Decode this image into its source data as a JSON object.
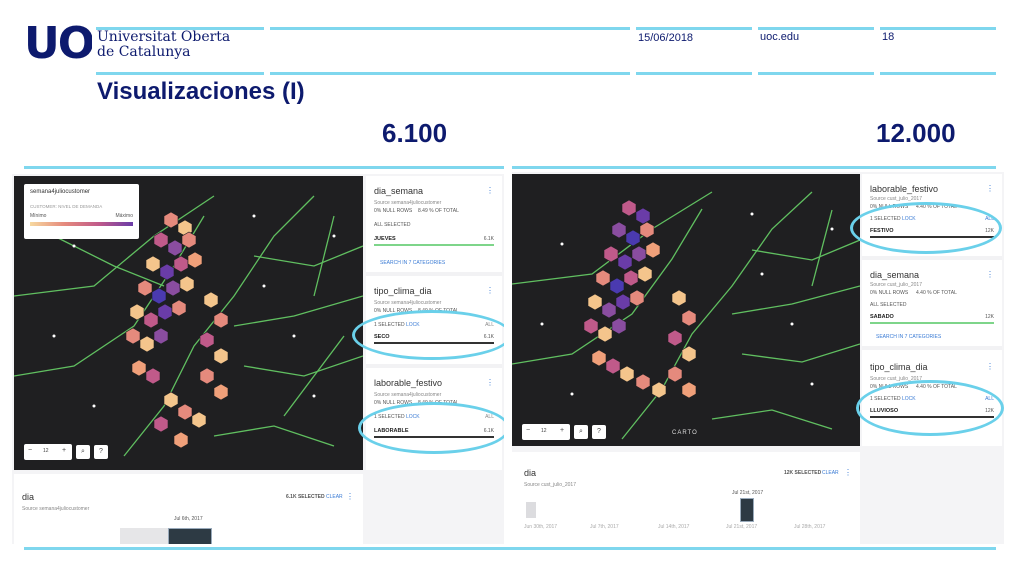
{
  "header": {
    "logo": "UOC",
    "university_line1": "Universitat Oberta",
    "university_line2": "de Catalunya",
    "date": "15/06/2018",
    "site": "uoc.edu",
    "page_number": "18"
  },
  "slide": {
    "title": "Visualizaciones (I)",
    "left_count": "6.100",
    "right_count": "12.000"
  },
  "left_shot": {
    "legend": {
      "layer": "semana4juliocustomer",
      "subtitle": "CUSTOMER: NIVEL DE DEMANDA",
      "min": "Mínimo",
      "max": "Máximo"
    },
    "zoom_level": "12",
    "cards": [
      {
        "title": "dia_semana",
        "source": "Source semana4juliocustomer",
        "null_rows": "0% NULL ROWS",
        "pct_total": "8.49 % OF TOTAL",
        "selected": "ALL SELECTED",
        "value": "JUEVES",
        "value_count": "6.1k",
        "search": "SEARCH IN 7 CATEGORIES"
      },
      {
        "title": "tipo_clima_dia",
        "source": "Source semana4juliocustomer",
        "null_rows": "0% NULL ROWS",
        "pct_total": "8.49 % OF TOTAL",
        "selected": "1 SELECTED",
        "lock": "LOCK",
        "all": "ALL",
        "value": "SECO",
        "value_count": "6.1k"
      },
      {
        "title": "laborable_festivo",
        "source": "Source semana4juliocustomer",
        "null_rows": "0% NULL ROWS",
        "pct_total": "8.49 % OF TOTAL",
        "selected": "1 SELECTED",
        "lock": "LOCK",
        "all": "ALL",
        "value": "LABORABLE",
        "value_count": "6.1k"
      }
    ],
    "timeline": {
      "title": "dia",
      "source": "Source semana4juliocustomer",
      "selected": "6.1K SELECTED",
      "clear": "CLEAR",
      "tooltip": "Jul 6th, 2017"
    }
  },
  "right_shot": {
    "zoom_level": "12",
    "attribution": "CARTO",
    "cards": [
      {
        "title": "laborable_festivo",
        "source": "Source cust_julio_2017",
        "null_rows": "0% NULL ROWS",
        "pct_total": "4.40 % OF TOTAL",
        "selected": "1 SELECTED",
        "lock": "LOCK",
        "all": "ALL",
        "value": "FESTIVO",
        "value_count": "12k"
      },
      {
        "title": "dia_semana",
        "source": "Source cust_julio_2017",
        "null_rows": "0% NULL ROWS",
        "pct_total": "4.40 % OF TOTAL",
        "selected": "ALL SELECTED",
        "value": "SABADO",
        "value_count": "12k",
        "search": "SEARCH IN 7 CATEGORIES"
      },
      {
        "title": "tipo_clima_dia",
        "source": "Source cust_julio_2017",
        "null_rows": "0% NULL ROWS",
        "pct_total": "4.40 % OF TOTAL",
        "selected": "1 SELECTED",
        "lock": "LOCK",
        "all": "ALL",
        "value": "LLUVIOSO",
        "value_count": "12k"
      }
    ],
    "timeline": {
      "title": "dia",
      "source": "Source cust_julio_2017",
      "selected": "12K SELECTED",
      "clear": "CLEAR",
      "tooltip": "Jul 21st, 2017",
      "ticks": [
        "Jun 30th, 2017",
        "Jul 7th, 2017",
        "Jul 14th, 2017",
        "Jul 21st, 2017",
        "Jul 28th, 2017"
      ]
    }
  },
  "colors": {
    "accent_bar": "#7fd7ee",
    "brand": "#0d1a6e",
    "oval": "#6ad0ea",
    "map_bg": "#1f1f21",
    "roads": "#6cdc6c"
  }
}
